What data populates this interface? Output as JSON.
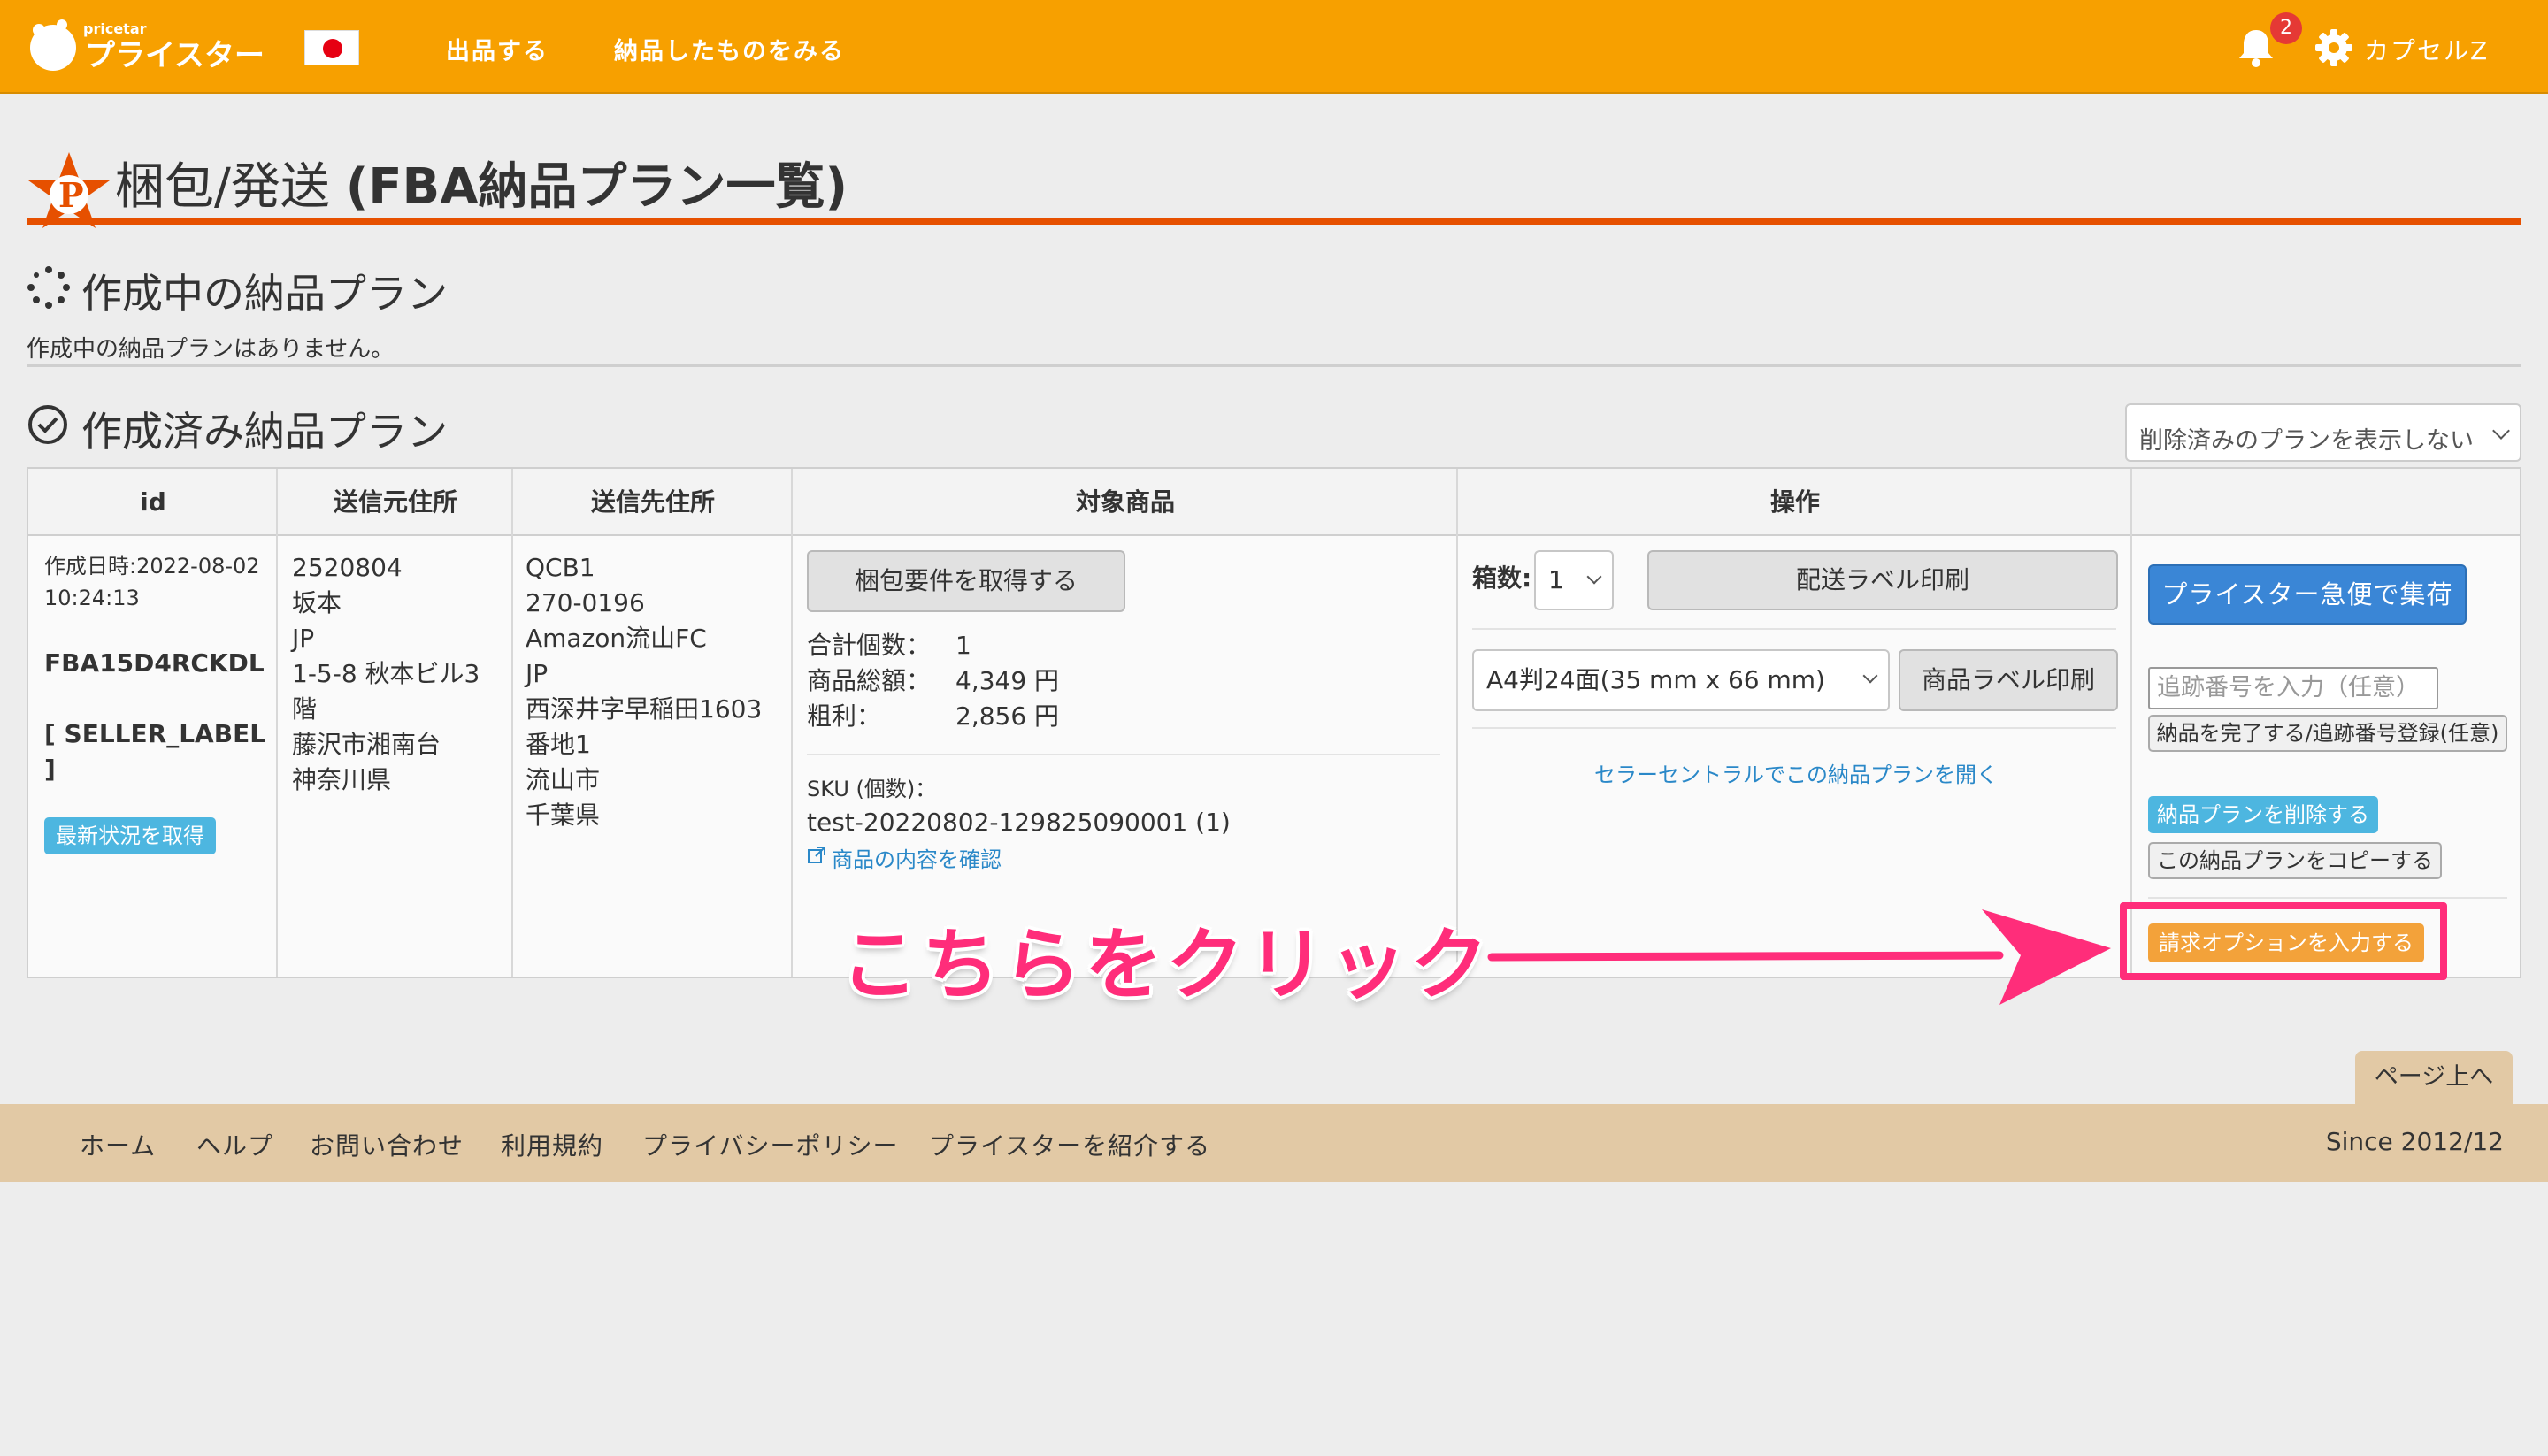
{
  "header": {
    "logo_small": "pricetar",
    "logo_main": "プライスター",
    "nav": [
      "出品する",
      "納品したものをみる"
    ],
    "notification_count": "2",
    "user_name": "カプセルZ"
  },
  "page": {
    "title_jp": "梱包/発送",
    "title_paren": "(FBA納品プラン一覧)"
  },
  "in_progress": {
    "title": "作成中の納品プラン",
    "empty_message": "作成中の納品プランはありません。"
  },
  "completed": {
    "title": "作成済み納品プラン",
    "filter_selected": "削除済みのプランを表示しない"
  },
  "table": {
    "headers": [
      "id",
      "送信元住所",
      "送信先住所",
      "対象商品",
      "操作",
      ""
    ],
    "row": {
      "created_at": "作成日時:2022-08-02\n10:24:13",
      "plan_id": "FBA15D4RCKDL",
      "seller_label": "[ SELLER_LABEL\n]",
      "refresh_button": "最新状況を取得",
      "from_address": "2520804\n坂本\nJP\n1-5-8 秋本ビル3\n階\n藤沢市湘南台\n神奈川県",
      "to_address": "QCB1\n270-0196\nAmazon流山FC\nJP\n西深井字早稲田1603\n番地1\n流山市\n千葉県",
      "get_packing_button": "梱包要件を取得する",
      "total_qty_label": "合計個数：",
      "total_qty": "1",
      "total_amount_label": "商品総額：",
      "total_amount": "4,349 円",
      "profit_label": "粗利：",
      "profit": "2,856 円",
      "sku_label": "SKU (個数)：",
      "sku_value": "test-20220802-129825090001 (1)",
      "check_items_link": "商品の内容を確認",
      "box_count_label": "箱数:",
      "box_count_value": "1",
      "shipping_label_button": "配送ラベル印刷",
      "label_format": "A4判24面(35 mm x 66 mm)",
      "product_label_button": "商品ラベル印刷",
      "seller_central_link": "セラーセントラルでこの納品プランを開く",
      "express_pickup_button": "プライスター急便で集荷",
      "tracking_placeholder": "追跡番号を入力（任意）",
      "complete_button": "納品を完了する/追跡番号登録(任意)",
      "delete_plan_button": "納品プランを削除する",
      "copy_plan_button": "この納品プランをコピーする",
      "billing_option_button": "請求オプションを入力する"
    }
  },
  "annotation": {
    "text": "こちらをクリック"
  },
  "footer": {
    "page_top": "ページ上へ",
    "links": [
      "ホーム",
      "ヘルプ",
      "お問い合わせ",
      "利用規約",
      "プライバシーポリシー",
      "プライスターを紹介する"
    ],
    "since": "Since 2012/12"
  },
  "colors": {
    "header": "#f7a000",
    "title_rule": "#e65000",
    "annotation": "#ff2d7a",
    "footer": "#e2c9a5"
  }
}
